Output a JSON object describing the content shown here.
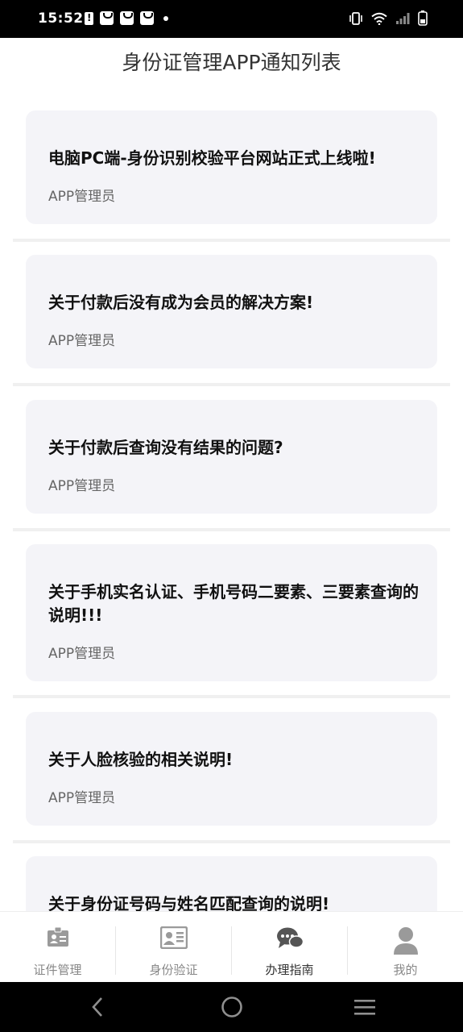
{
  "status": {
    "time": "15:52"
  },
  "page": {
    "title": "身份证管理APP通知列表"
  },
  "notices": [
    {
      "title": "电脑PC端-身份识别校验平台网站正式上线啦!",
      "author": "APP管理员"
    },
    {
      "title": "关于付款后没有成为会员的解决方案!",
      "author": "APP管理员"
    },
    {
      "title": "关于付款后查询没有结果的问题?",
      "author": "APP管理员"
    },
    {
      "title": "关于手机实名认证、手机号码二要素、三要素查询的说明!!!",
      "author": "APP管理员"
    },
    {
      "title": "关于人脸核验的相关说明!",
      "author": "APP管理员"
    },
    {
      "title": "关于身份证号码与姓名匹配查询的说明!"
    }
  ],
  "tabs": [
    {
      "label": "证件管理",
      "icon": "id-card-icon"
    },
    {
      "label": "身份验证",
      "icon": "identity-verify-icon"
    },
    {
      "label": "办理指南",
      "icon": "chat-bubbles-icon",
      "active": true
    },
    {
      "label": "我的",
      "icon": "user-icon"
    }
  ],
  "colors": {
    "card_bg": "#f4f4f8",
    "tab_icon": "#9a9a9a",
    "active_icon": "#555555"
  }
}
